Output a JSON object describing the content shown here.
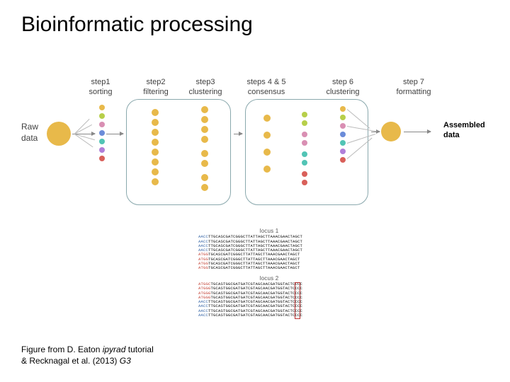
{
  "title": "Bioinformatic processing",
  "raw_label_l1": "Raw",
  "raw_label_l2": "data",
  "assembled_l1": "Assembled",
  "assembled_l2": "data",
  "steps": {
    "s1": {
      "line1": "step1",
      "line2": "sorting"
    },
    "s2": {
      "line1": "step2",
      "line2": "filtering"
    },
    "s3": {
      "line1": "step3",
      "line2": "clustering"
    },
    "s45": {
      "line1": "steps 4 & 5",
      "line2": "consensus"
    },
    "s6": {
      "line1": "step 6",
      "line2": "clustering"
    },
    "s7": {
      "line1": "step 7",
      "line2": "formatting"
    }
  },
  "locus1_label": "locus 1",
  "locus2_label": "locus 2",
  "seq": {
    "l1": [
      {
        "tag": "AACC",
        "body": "TTGCASCGATCGGGCTTATTAGCTTAAACGAACTAGCT"
      },
      {
        "tag": "AACC",
        "body": "TTGCASCGATCGGGCTTATTAGCTTAAACGAACTAGCT"
      },
      {
        "tag": "AACC",
        "body": "TTGCASCGATCGGGCTTATTAGCTTAAACGAACTAGCT"
      },
      {
        "tag": "AACC",
        "body": "TTGCASCGATCGGGCTTATTAGCTTAAACGAACTAGCT"
      },
      {
        "tag": "ATGG",
        "body": "TGCASCGATCGGGCTTATTAGCTTAAACGAACTAGCT"
      },
      {
        "tag": "ATGG",
        "body": "TGCASCGATCGGGCTTATTAGCTTAAACGAACTAGCT"
      },
      {
        "tag": "ATGG",
        "body": "TGCASCGATCGGGCTTATTAGCTTAAACGAACTAGCT"
      },
      {
        "tag": "ATGG",
        "body": "TGCASCGATCGGGCTTATTAGCTTAAACGAACTAGCT"
      }
    ],
    "l2": [
      {
        "tag": "ATGGC",
        "body": "TGCASTGGCGATGATCGTAGCAACGATGGTACTCCCC"
      },
      {
        "tag": "ATGGG",
        "body": "TGCASTGGCGATGATCGTAGCAACGATGGTACTCCCC"
      },
      {
        "tag": "ATGGG",
        "body": "TGCASTGGCGATGATCGTAGCAACGATGGTACTCCCC"
      },
      {
        "tag": "ATGGG",
        "body": "TGCASTGGCGATGATCGTAGCAACGATGGTACTCCCC"
      },
      {
        "tag": "AACC",
        "body": "TTGCASTGGCGATGATCGTAGCAACGATGGTACTCCCC"
      },
      {
        "tag": "AACC",
        "body": "TTGCASTGGCGATGATCGTAGCAACGATGGTACTCCCC"
      },
      {
        "tag": "AACC",
        "body": "TTGCASTGGCGATGATCGTAGCAACGATGGTACTCCCC"
      },
      {
        "tag": "AACC",
        "body": "TTGCASTGGCGATGATCGTAGCAACGATGGTACTCCCC"
      }
    ]
  },
  "citation_l1_a": "Figure from D. Eaton ",
  "citation_l1_b": "ipyrad",
  "citation_l1_c": " tutorial",
  "citation_l2_a": "& Recknagal et al. (2013) ",
  "citation_l2_b": "G3",
  "colors": {
    "orange": "#e8b94a",
    "green": "#b7cf4a",
    "pink": "#d98fb3",
    "blue": "#6b8cd9",
    "teal": "#52c4b5",
    "purple": "#b07fd9",
    "red": "#d9605a"
  }
}
